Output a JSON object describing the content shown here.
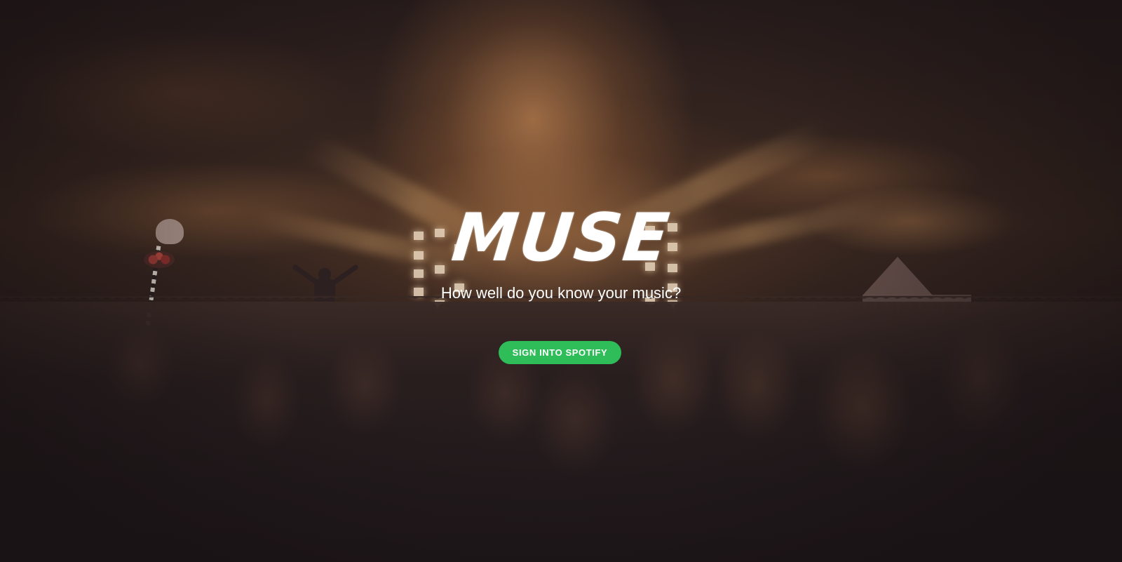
{
  "app": {
    "logo_text": "MUSE",
    "tagline": "How well do you know your music?"
  },
  "actions": {
    "sign_in_label": "SIGN INTO SPOTIFY"
  },
  "colors": {
    "accent": "#2ebd59",
    "text": "#ffffff",
    "background": "#221a1c"
  },
  "background": {
    "image": "concert-crowd-photo"
  }
}
